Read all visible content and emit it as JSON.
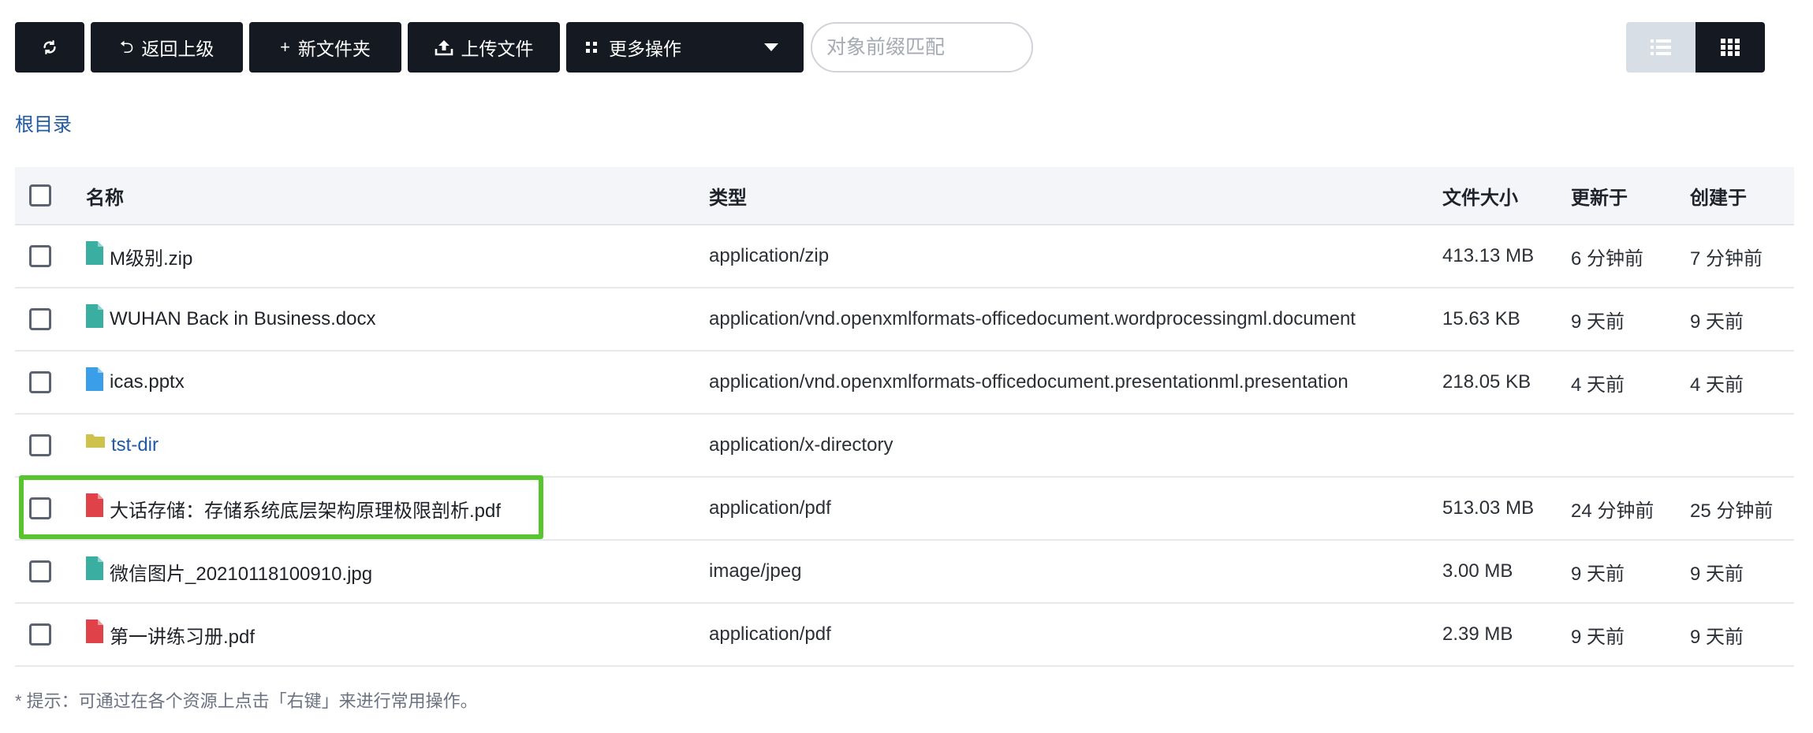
{
  "toolbar": {
    "refresh_icon": "refresh-icon",
    "back_label": "返回上级",
    "new_folder_label": "新文件夹",
    "upload_label": "上传文件",
    "more_label": "更多操作",
    "search_placeholder": "对象前缀匹配"
  },
  "view": {
    "list_icon": "list-view-icon",
    "grid_icon": "grid-view-icon",
    "active": "grid"
  },
  "breadcrumb": {
    "root": "根目录"
  },
  "table": {
    "headers": {
      "name": "名称",
      "type": "类型",
      "size": "文件大小",
      "updated": "更新于",
      "created": "创建于"
    },
    "rows": [
      {
        "name": "M级别.zip",
        "icon": "zip-file-icon",
        "icon_color": "#3aaea0",
        "type": "application/zip",
        "size": "413.13 MB",
        "updated": "6 分钟前",
        "created": "7 分钟前"
      },
      {
        "name": "WUHAN Back in Business.docx",
        "icon": "doc-file-icon",
        "icon_color": "#3aaea0",
        "type": "application/vnd.openxmlformats-officedocument.wordprocessingml.document",
        "size": "15.63 KB",
        "updated": "9 天前",
        "created": "9 天前"
      },
      {
        "name": "icas.pptx",
        "icon": "ppt-file-icon",
        "icon_color": "#3a9ee8",
        "type": "application/vnd.openxmlformats-officedocument.presentationml.presentation",
        "size": "218.05 KB",
        "updated": "4 天前",
        "created": "4 天前"
      },
      {
        "name": "tst-dir",
        "icon": "folder-icon",
        "icon_color": "#cfc24a",
        "type": "application/x-directory",
        "size": "",
        "updated": "",
        "created": ""
      },
      {
        "name": "大话存储：存储系统底层架构原理极限剖析.pdf",
        "icon": "pdf-file-icon",
        "icon_color": "#e0424a",
        "type": "application/pdf",
        "size": "513.03 MB",
        "updated": "24 分钟前",
        "created": "25 分钟前"
      },
      {
        "name": "微信图片_20210118100910.jpg",
        "icon": "jpg-file-icon",
        "icon_color": "#3aaea0",
        "type": "image/jpeg",
        "size": "3.00 MB",
        "updated": "9 天前",
        "created": "9 天前"
      },
      {
        "name": "第一讲练习册.pdf",
        "icon": "pdf-file-icon",
        "icon_color": "#e0424a",
        "type": "application/pdf",
        "size": "2.39 MB",
        "updated": "9 天前",
        "created": "9 天前"
      }
    ]
  },
  "highlight_color": "#58c430",
  "hint": "* 提示：可通过在各个资源上点击「右键」来进行常用操作。"
}
